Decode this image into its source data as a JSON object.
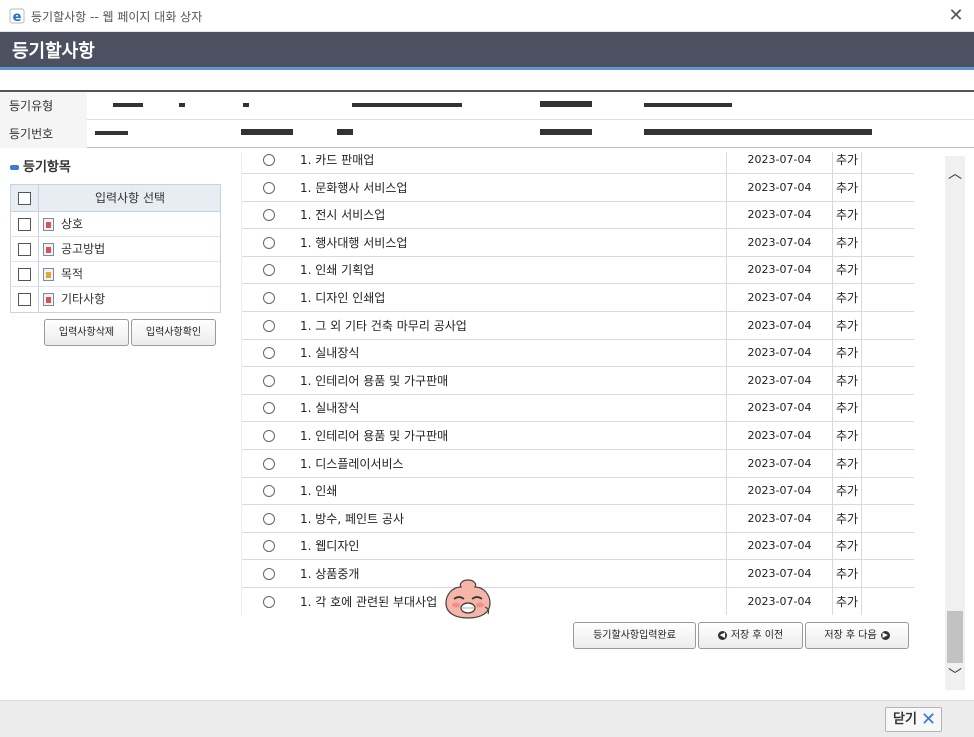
{
  "window": {
    "title": "등기할사항 -- 웹 페이지 대화 상자",
    "close_glyph": "✕"
  },
  "header": {
    "title": "등기할사항"
  },
  "info": {
    "label_type": "등기유형",
    "label_number": "등기번호"
  },
  "left_panel": {
    "section_title": "등기항목",
    "table_header": "입력사항 선택",
    "items": [
      {
        "label": "상호",
        "icon": "document-icon"
      },
      {
        "label": "공고방법",
        "icon": "document-icon"
      },
      {
        "label": "목적",
        "icon": "document-edit-icon"
      },
      {
        "label": "기타사항",
        "icon": "document-icon"
      }
    ],
    "buttons": {
      "delete": "입력사항삭제",
      "confirm": "입력사항확인"
    }
  },
  "rows": [
    {
      "text": "1. 카드 판매업",
      "date": "2023-07-04",
      "status": "추가"
    },
    {
      "text": "1. 문화행사 서비스업",
      "date": "2023-07-04",
      "status": "추가"
    },
    {
      "text": "1. 전시 서비스업",
      "date": "2023-07-04",
      "status": "추가"
    },
    {
      "text": "1. 행사대행 서비스업",
      "date": "2023-07-04",
      "status": "추가"
    },
    {
      "text": "1. 인쇄 기획업",
      "date": "2023-07-04",
      "status": "추가"
    },
    {
      "text": "1. 디자인 인쇄업",
      "date": "2023-07-04",
      "status": "추가"
    },
    {
      "text": "1. 그 외 기타 건축 마무리 공사업",
      "date": "2023-07-04",
      "status": "추가"
    },
    {
      "text": "1. 실내장식",
      "date": "2023-07-04",
      "status": "추가"
    },
    {
      "text": "1. 인테리어 용품 및 가구판매",
      "date": "2023-07-04",
      "status": "추가"
    },
    {
      "text": "1. 실내장식",
      "date": "2023-07-04",
      "status": "추가"
    },
    {
      "text": "1. 인테리어 용품 및 가구판매",
      "date": "2023-07-04",
      "status": "추가"
    },
    {
      "text": "1. 디스플레이서비스",
      "date": "2023-07-04",
      "status": "추가"
    },
    {
      "text": "1. 인쇄",
      "date": "2023-07-04",
      "status": "추가"
    },
    {
      "text": "1. 방수, 페인트 공사",
      "date": "2023-07-04",
      "status": "추가"
    },
    {
      "text": "1. 웹디자인",
      "date": "2023-07-04",
      "status": "추가"
    },
    {
      "text": "1. 상품중개",
      "date": "2023-07-04",
      "status": "추가"
    },
    {
      "text": "1. 각 호에 관련된 부대사업",
      "date": "2023-07-04",
      "status": "추가"
    }
  ],
  "actions": {
    "complete": "등기할사항입력완료",
    "prev": "저장 후 이전",
    "next": "저장 후 다음"
  },
  "footer": {
    "close": "닫기"
  },
  "colors": {
    "header_bg": "#4d5060",
    "accent_line": "#5f95d1",
    "bullet": "#3a7bd5"
  }
}
